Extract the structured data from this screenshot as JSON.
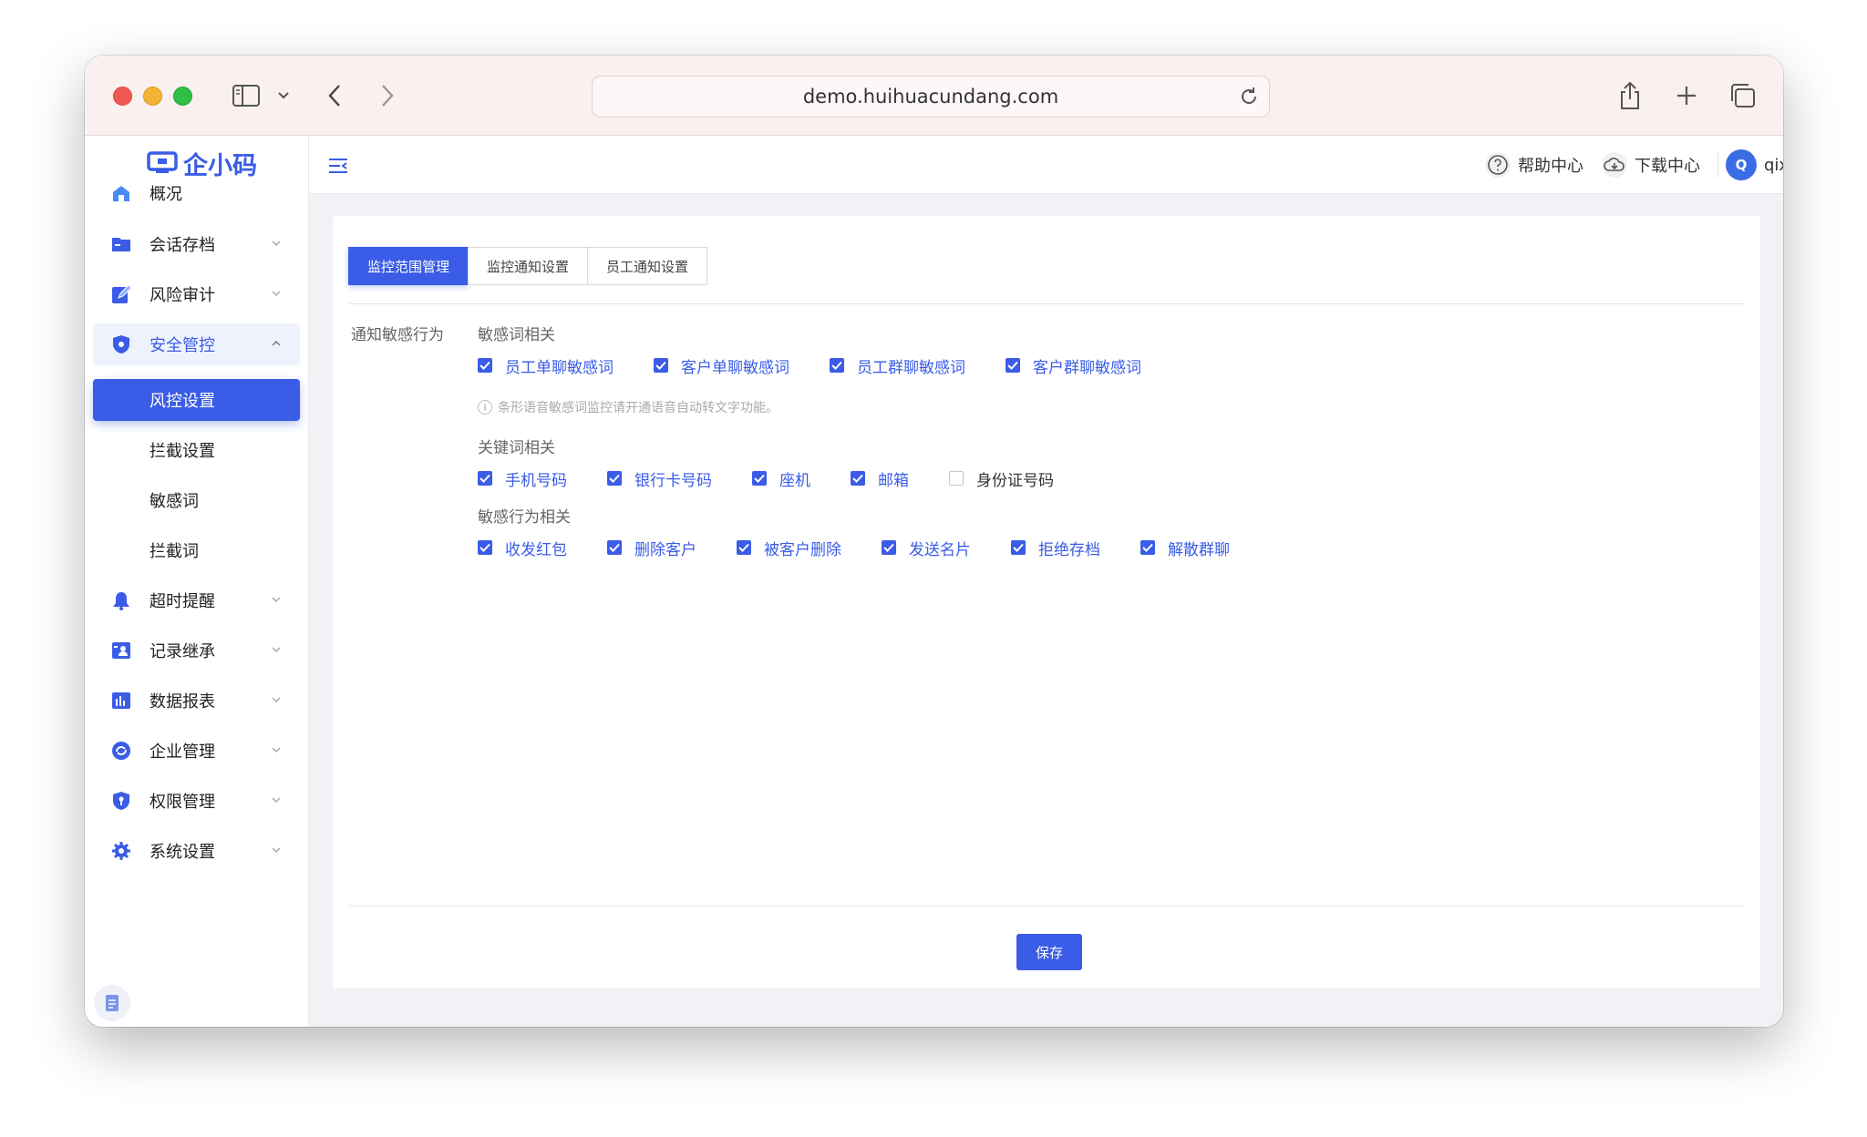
{
  "browser": {
    "url": "demo.huihuacundang.com"
  },
  "app": {
    "logo_text": "企小码"
  },
  "sidebar": {
    "items": [
      {
        "label": "概况",
        "icon": "home-icon"
      },
      {
        "label": "会话存档",
        "icon": "folder-icon"
      },
      {
        "label": "风险审计",
        "icon": "edit-icon"
      },
      {
        "label": "安全管控",
        "icon": "shield-icon"
      },
      {
        "label": "风控设置"
      },
      {
        "label": "拦截设置"
      },
      {
        "label": "敏感词"
      },
      {
        "label": "拦截词"
      },
      {
        "label": "超时提醒",
        "icon": "bell-icon"
      },
      {
        "label": "记录继承",
        "icon": "user-card-icon"
      },
      {
        "label": "数据报表",
        "icon": "bar-chart-icon"
      },
      {
        "label": "企业管理",
        "icon": "refresh-icon"
      },
      {
        "label": "权限管理",
        "icon": "key-shield-icon"
      },
      {
        "label": "系统设置",
        "icon": "gear-icon"
      }
    ]
  },
  "header": {
    "help": "帮助中心",
    "download": "下载中心",
    "avatar_letter": "Q",
    "username": "qixiaoma"
  },
  "tabs": [
    "监控范围管理",
    "监控通知设置",
    "员工通知设置"
  ],
  "form": {
    "label": "通知敏感行为",
    "groups": [
      {
        "title": "敏感词相关",
        "options": [
          {
            "label": "员工单聊敏感词",
            "checked": true
          },
          {
            "label": "客户单聊敏感词",
            "checked": true
          },
          {
            "label": "员工群聊敏感词",
            "checked": true
          },
          {
            "label": "客户群聊敏感词",
            "checked": true
          }
        ],
        "hint": "条形语音敏感词监控请开通语音自动转文字功能。"
      },
      {
        "title": "关键词相关",
        "options": [
          {
            "label": "手机号码",
            "checked": true
          },
          {
            "label": "银行卡号码",
            "checked": true
          },
          {
            "label": "座机",
            "checked": true
          },
          {
            "label": "邮箱",
            "checked": true
          },
          {
            "label": "身份证号码",
            "checked": false
          }
        ]
      },
      {
        "title": "敏感行为相关",
        "options": [
          {
            "label": "收发红包",
            "checked": true
          },
          {
            "label": "删除客户",
            "checked": true
          },
          {
            "label": "被客户删除",
            "checked": true
          },
          {
            "label": "发送名片",
            "checked": true
          },
          {
            "label": "拒绝存档",
            "checked": true
          },
          {
            "label": "解散群聊",
            "checked": true
          }
        ]
      }
    ],
    "save_label": "保存"
  }
}
